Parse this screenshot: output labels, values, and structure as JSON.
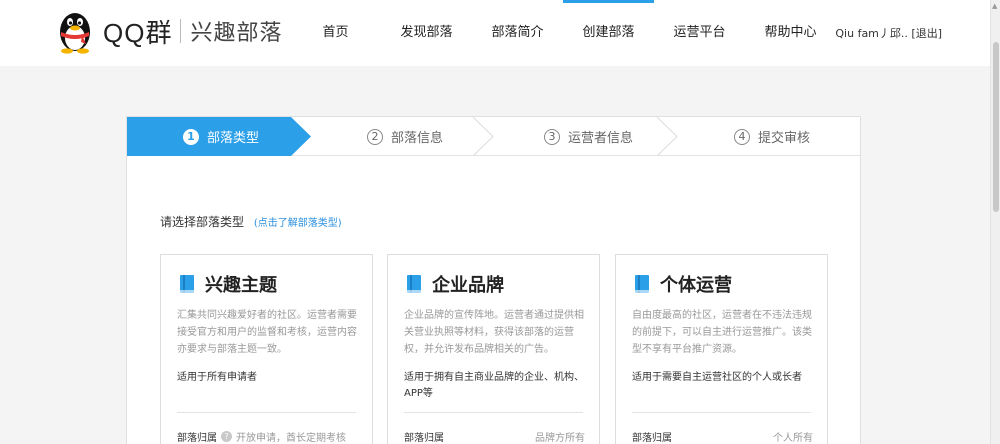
{
  "header": {
    "brand_main": "QQ群",
    "brand_sub": "兴趣部落",
    "nav": [
      {
        "label": "首页"
      },
      {
        "label": "发现部落"
      },
      {
        "label": "部落简介"
      },
      {
        "label": "创建部落"
      },
      {
        "label": "运营平台"
      },
      {
        "label": "帮助中心"
      }
    ],
    "active_nav": "创建部落",
    "user_name": "Qiu fam丿邱..",
    "logout": "[退出]"
  },
  "steps": [
    {
      "num": "1",
      "label": "部落类型"
    },
    {
      "num": "2",
      "label": "部落信息"
    },
    {
      "num": "3",
      "label": "运营者信息"
    },
    {
      "num": "4",
      "label": "提交审核"
    }
  ],
  "prompt": {
    "text": "请选择部落类型",
    "link": "(点击了解部落类型)"
  },
  "cards": [
    {
      "title": "兴趣主题",
      "desc": "汇集共同兴趣爱好者的社区。运营者需要接受官方和用户的监督和考核，运营内容亦要求与部落主题一致。",
      "apply": "适用于所有申请者",
      "owner_label": "部落归属",
      "owner_value": "开放申请，酋长定期考核"
    },
    {
      "title": "企业品牌",
      "desc": "企业品牌的宣传阵地。运营者通过提供相关营业执照等材料，获得该部落的运营权，并允许发布品牌相关的广告。",
      "apply": "适用于拥有自主商业品牌的企业、机构、APP等",
      "owner_label": "部落归属",
      "owner_value": "品牌方所有"
    },
    {
      "title": "个体运营",
      "desc": "自由度最高的社区，运营者在不违法违规的前提下，可以自主进行运营推广。该类型不享有平台推广资源。",
      "apply": "适用于需要自主运营社区的个人或长者",
      "owner_label": "部落归属",
      "owner_value": "个人所有"
    }
  ],
  "colors": {
    "accent": "#2b9fe8",
    "link": "#2b8fdc"
  }
}
